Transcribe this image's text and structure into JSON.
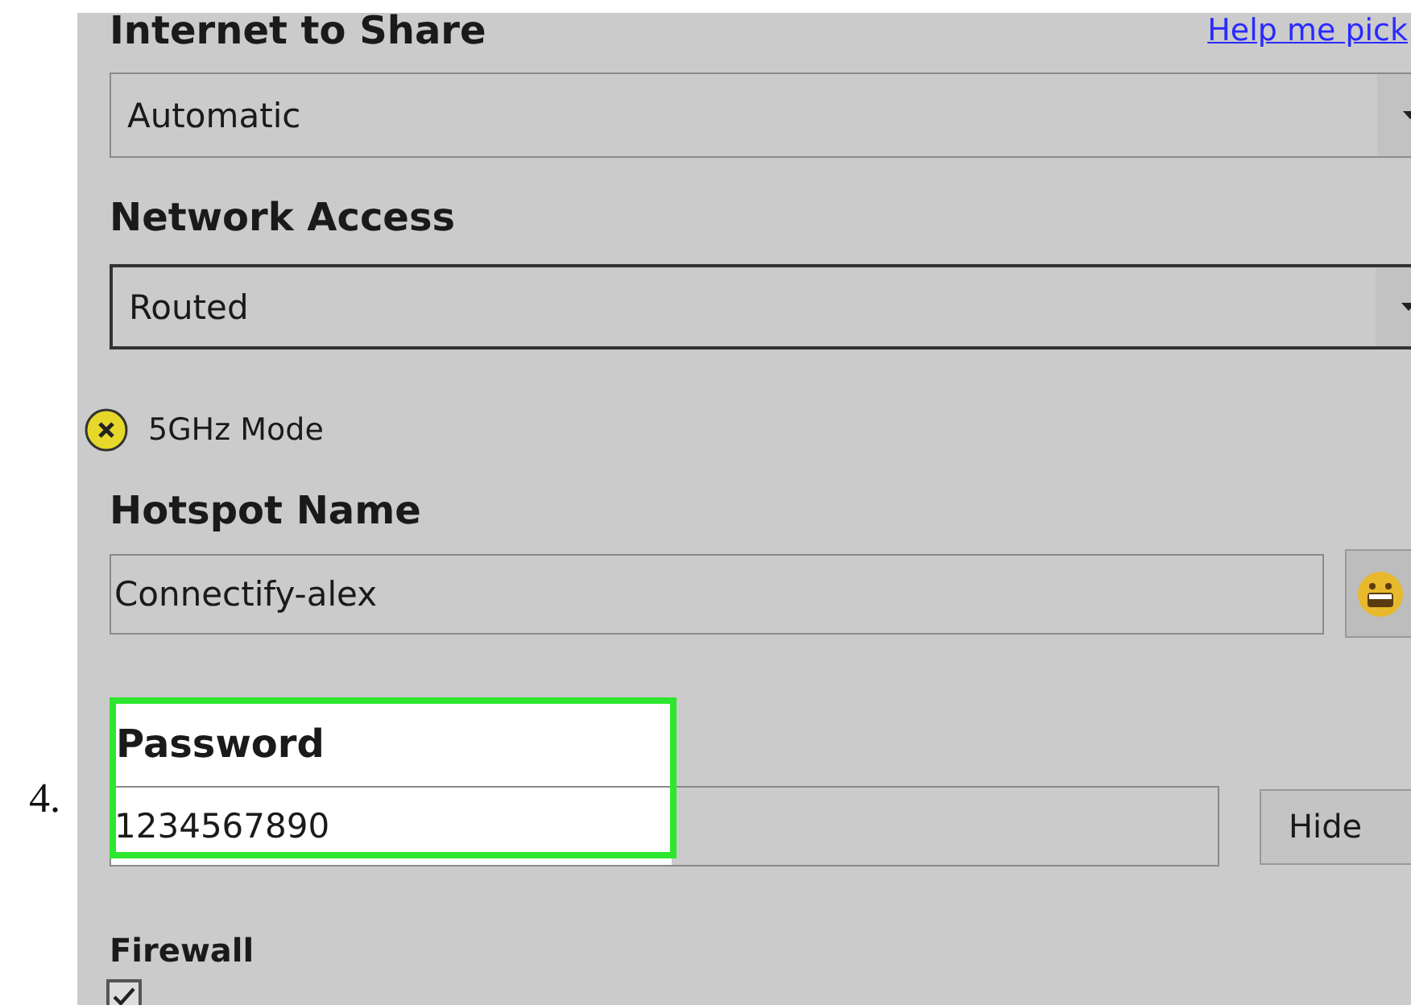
{
  "step_number": "4.",
  "internet_to_share": {
    "label": "Internet to Share",
    "help_link": "Help me pick",
    "value": "Automatic"
  },
  "network_access": {
    "label": "Network Access",
    "value": "Routed"
  },
  "mode_5ghz": {
    "label": "5GHz Mode",
    "on": false
  },
  "hotspot_name": {
    "label": "Hotspot Name",
    "value": "Connectify-alex"
  },
  "password": {
    "label": "Password",
    "value": "1234567890",
    "highlighted": true,
    "button": "Hide"
  },
  "firewall": {
    "label": "Firewall",
    "allow_internet_access": {
      "checked": true
    }
  }
}
